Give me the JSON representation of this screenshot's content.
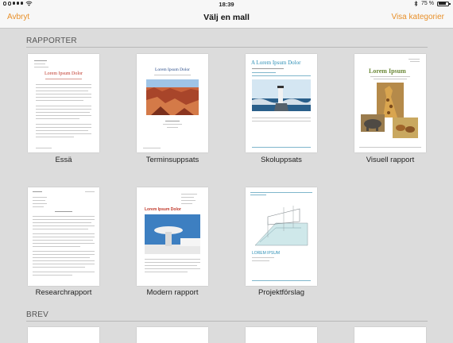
{
  "status_bar": {
    "time": "18:39",
    "battery_percent_label": "75 %",
    "battery_level": 0.75,
    "bluetooth_icon": "bluetooth-icon",
    "wifi_icon": "wifi-icon"
  },
  "nav": {
    "cancel_label": "Avbryt",
    "title": "Välj en mall",
    "categories_label": "Visa kategorier",
    "accent_color": "#e8902a"
  },
  "sections": {
    "reports": {
      "header": "RAPPORTER",
      "templates": [
        {
          "name": "Essä",
          "preview_title": "Lorem Ipsum Dolor"
        },
        {
          "name": "Terminsuppsats",
          "preview_title": "Lorem Ipsum Dolor"
        },
        {
          "name": "Skoluppsats",
          "preview_title": "A Lorem Ipsum Dolor"
        },
        {
          "name": "Visuell rapport",
          "preview_title": "Lorem Ipsum"
        },
        {
          "name": "Researchrapport",
          "preview_title": ""
        },
        {
          "name": "Modern rapport",
          "preview_title": "Lorem Ipsum Dolor"
        },
        {
          "name": "Projektförslag",
          "preview_title": "LOREM IPSUM"
        }
      ]
    },
    "letters": {
      "header": "BREV"
    }
  }
}
